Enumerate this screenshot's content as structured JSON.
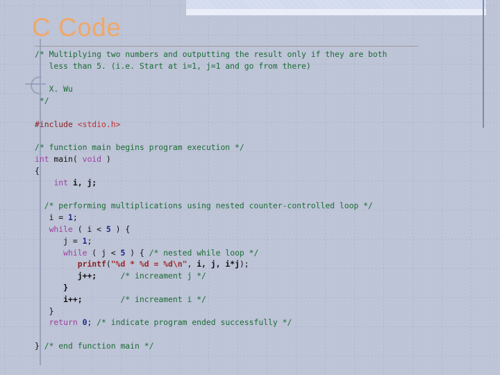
{
  "slide": {
    "title": "C Code",
    "accent_color": "#f0a868",
    "banner_color": "#c3cfe9",
    "deco_line_color": "#97a3bd",
    "background_color": "#ffffff"
  },
  "code": {
    "language": "C",
    "comment_color": "#1a6b35",
    "keyword_color": "#9b3fa0",
    "string_color": "#a02828",
    "number_color": "#1a2a8b",
    "preprocessor_color": "#8b2020",
    "lines": [
      [
        {
          "t": "/* Multiplying two numbers and outputting the result only if they are both",
          "c": "cm"
        }
      ],
      [
        {
          "t": "   less than 5. (i.e. Start at i=1, ",
          "c": "cm"
        },
        {
          "t": "j=1",
          "c": "cm"
        },
        {
          "t": " and go from there)",
          "c": "cm"
        }
      ],
      [],
      [
        {
          "t": "   X. Wu",
          "c": "cm"
        }
      ],
      [
        {
          "t": " */",
          "c": "cm"
        }
      ],
      [],
      [
        {
          "t": "#include ",
          "c": "pp"
        },
        {
          "t": "<stdio.h>",
          "c": "inc"
        }
      ],
      [],
      [
        {
          "t": "/* function main begins program execution */",
          "c": "cm"
        }
      ],
      [
        {
          "t": "int",
          "c": "kw"
        },
        {
          "t": " main( ",
          "c": "pl"
        },
        {
          "t": "void",
          "c": "kw"
        },
        {
          "t": " )",
          "c": "pl"
        }
      ],
      [
        {
          "t": "{",
          "c": "pl"
        }
      ],
      [
        {
          "t": "    ",
          "c": "pl"
        },
        {
          "t": "int",
          "c": "kw"
        },
        {
          "t": " ",
          "c": "pl"
        },
        {
          "t": "i, j;",
          "c": "id"
        }
      ],
      [],
      [
        {
          "t": "  /* performing multiplications using nested counter-controlled loop */",
          "c": "cm"
        }
      ],
      [
        {
          "t": "   i = ",
          "c": "pl"
        },
        {
          "t": "1",
          "c": "num"
        },
        {
          "t": ";",
          "c": "pl"
        }
      ],
      [
        {
          "t": "   ",
          "c": "pl"
        },
        {
          "t": "while",
          "c": "kw"
        },
        {
          "t": " ( i < ",
          "c": "pl"
        },
        {
          "t": "5",
          "c": "num"
        },
        {
          "t": " ) {",
          "c": "pl"
        }
      ],
      [
        {
          "t": "      j = ",
          "c": "pl"
        },
        {
          "t": "1",
          "c": "num"
        },
        {
          "t": ";",
          "c": "pl"
        }
      ],
      [
        {
          "t": "      ",
          "c": "pl"
        },
        {
          "t": "while",
          "c": "kw"
        },
        {
          "t": " ( j < ",
          "c": "pl"
        },
        {
          "t": "5",
          "c": "num"
        },
        {
          "t": " ) { ",
          "c": "pl"
        },
        {
          "t": "/* nested while loop */",
          "c": "cm"
        }
      ],
      [
        {
          "t": "         ",
          "c": "pl"
        },
        {
          "t": "printf",
          "c": "fn"
        },
        {
          "t": "(",
          "c": "pl"
        },
        {
          "t": "\"%d * %d = %d\\n\"",
          "c": "str"
        },
        {
          "t": ", ",
          "c": "pl"
        },
        {
          "t": "i, j, i*j",
          "c": "id"
        },
        {
          "t": ");",
          "c": "pl"
        }
      ],
      [
        {
          "t": "         ",
          "c": "pl"
        },
        {
          "t": "j++;",
          "c": "id"
        },
        {
          "t": "     ",
          "c": "pl"
        },
        {
          "t": "/* increament j */",
          "c": "cm"
        }
      ],
      [
        {
          "t": "      }",
          "c": "id"
        }
      ],
      [
        {
          "t": "      ",
          "c": "pl"
        },
        {
          "t": "i++;",
          "c": "id"
        },
        {
          "t": "        ",
          "c": "pl"
        },
        {
          "t": "/* increament i */",
          "c": "cm"
        }
      ],
      [
        {
          "t": "   }",
          "c": "pl"
        }
      ],
      [
        {
          "t": "   ",
          "c": "pl"
        },
        {
          "t": "return",
          "c": "kw"
        },
        {
          "t": " ",
          "c": "pl"
        },
        {
          "t": "0",
          "c": "num"
        },
        {
          "t": "; ",
          "c": "pl"
        },
        {
          "t": "/* indicate program ended successfully */",
          "c": "cm"
        }
      ],
      [],
      [
        {
          "t": "} ",
          "c": "pl"
        },
        {
          "t": "/* end function main */",
          "c": "cm"
        }
      ]
    ]
  }
}
